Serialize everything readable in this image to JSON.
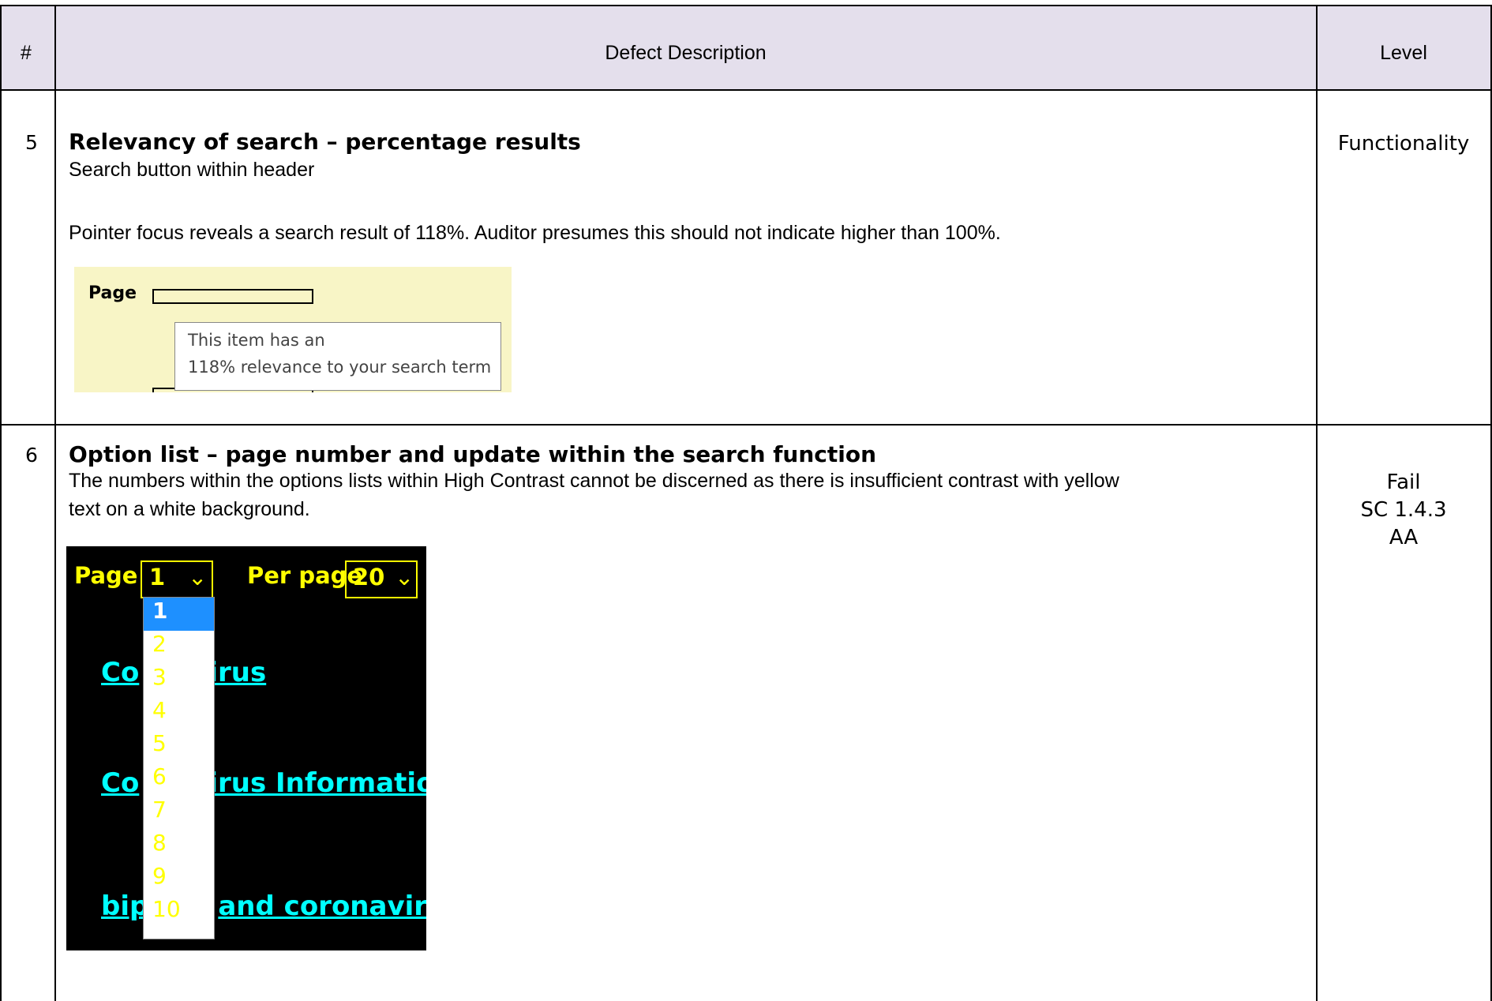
{
  "header": {
    "num": "#",
    "description": "Defect Description",
    "level": "Level"
  },
  "rows": [
    {
      "num": "5",
      "title": "Relevancy of search – percentage results",
      "subtitle": "Search button within header",
      "body": "Pointer focus reveals a search result of 118%. Auditor presumes this should not indicate higher than 100%.",
      "level": "Functionality",
      "screenshot": {
        "label": "Page",
        "tooltip_line1": "This item has an",
        "tooltip_line2": "118% relevance to your search term"
      }
    },
    {
      "num": "6",
      "title": "Option list – page number and update within the search function",
      "body_line1": "The numbers within the options lists within High Contrast cannot be discerned as there is insufficient contrast with yellow",
      "body_line2": "text on a white background.",
      "level_lines": [
        "Fail",
        "SC 1.4.3",
        "AA"
      ],
      "screenshot": {
        "page_label": "Page",
        "page_value": "1",
        "per_page_label": "Per page",
        "per_page_value": "20",
        "options": [
          "1",
          "2",
          "3",
          "4",
          "5",
          "6",
          "7",
          "8",
          "9",
          "10"
        ],
        "links": [
          "Coronavirus",
          "Coronavirus Information",
          "bipolar and coronavirus"
        ],
        "visible_links": [
          "Co",
          "irus",
          "Co",
          "irus Informatio",
          "bip",
          "and coronavirus"
        ]
      }
    }
  ],
  "colors": {
    "header_bg": "#e4dfec",
    "tooltip_bg": "#f8f5c6",
    "hc_text": "#ffff00",
    "hc_link": "#00ffff",
    "selected": "#1e90ff"
  }
}
